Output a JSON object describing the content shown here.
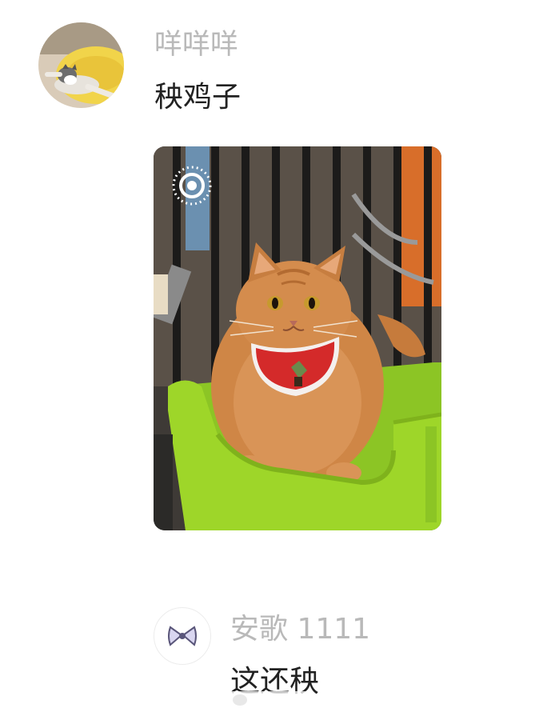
{
  "post1": {
    "username": "咩咩咩",
    "text": "秧鸡子",
    "avatar_icon": "kitten-on-yellow-bed-avatar",
    "photo_icon": "orange-cat-in-green-basket-photo",
    "live_badge_icon": "live-photo-icon"
  },
  "post2": {
    "username": "安歌 1111",
    "text": "这还秧",
    "avatar_icon": "bow-ribbon-avatar"
  },
  "colors": {
    "username": "#b9b9b9",
    "text": "#222222",
    "background": "#ffffff",
    "basket_green": "#9ed629",
    "cat_orange": "#d48a4a"
  }
}
